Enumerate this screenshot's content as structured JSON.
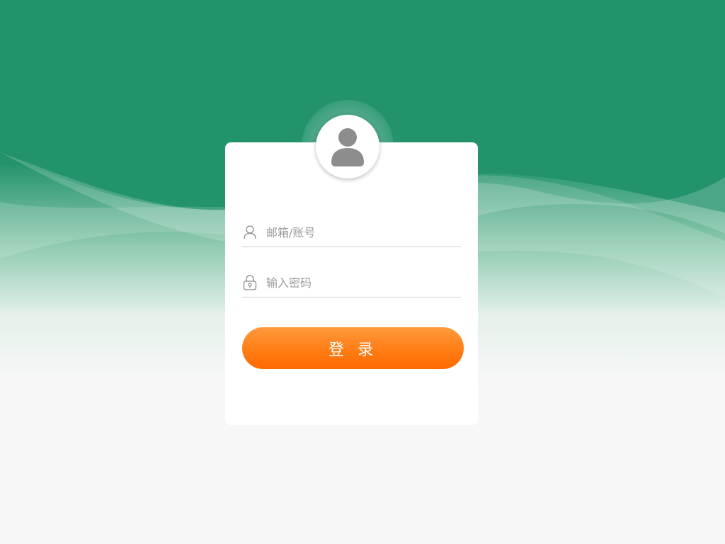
{
  "login": {
    "username_placeholder": "邮箱/账号",
    "password_placeholder": "输入密码",
    "submit_label": "登 录"
  },
  "theme": {
    "primary_green": "#23936c",
    "accent_orange": "#ff7a12",
    "background": "#f7f7f7"
  },
  "icons": {
    "avatar": "user-avatar-icon",
    "username": "user-icon",
    "password": "lock-icon"
  }
}
